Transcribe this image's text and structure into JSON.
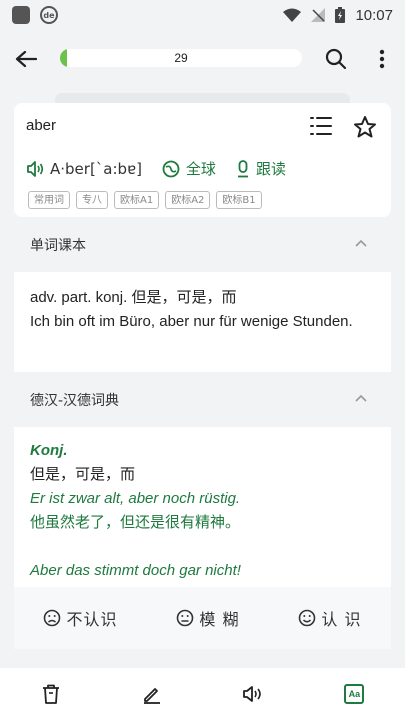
{
  "status": {
    "app_icon": "de",
    "time": "10:07"
  },
  "header": {
    "progress_count": "29",
    "progress_fraction": 0.03
  },
  "word_card": {
    "word": "aber",
    "pronunciation": "A·ber[`a:bɐ]",
    "global_label": "全球",
    "follow_read_label": "跟读",
    "tags": [
      "常用词",
      "专八",
      "欧标A1",
      "欧标A2",
      "欧标B1"
    ]
  },
  "textbook": {
    "title": "单词课本",
    "definition": "adv. part. konj. 但是，可是，而",
    "example": "Ich bin oft im Büro, aber nur für wenige Stunden."
  },
  "dictionary": {
    "title": "德汉-汉德词典",
    "pos": "Konj.",
    "meaning": "但是，可是，而",
    "example1_de": "Er ist zwar alt, aber noch rüstig.",
    "example1_zh": "他虽然老了，但还是很有精神。",
    "example2_de": "Aber das stimmt doch gar nicht!"
  },
  "judge": {
    "unknown": "不认识",
    "vague": "模 糊",
    "known": "认 识"
  },
  "bottom_nav": {
    "aa_label": "Aa"
  },
  "colors": {
    "accent_green": "#1e7a3e",
    "progress_green": "#6cc24a"
  }
}
